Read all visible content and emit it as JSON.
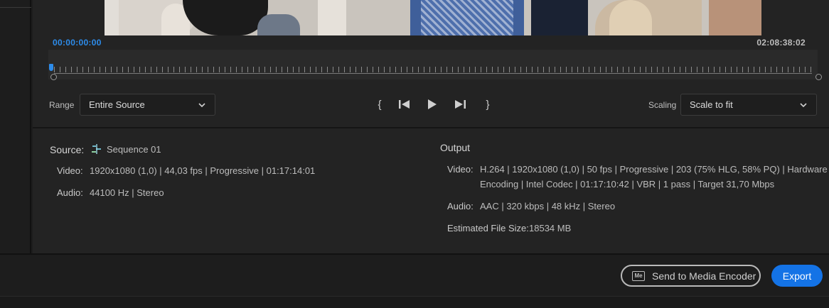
{
  "preview": {
    "timecode_start": "00:00:00:00",
    "timecode_end": "02:08:38:02"
  },
  "range": {
    "label": "Range",
    "value": "Entire Source"
  },
  "scaling": {
    "label": "Scaling",
    "value": "Scale to fit"
  },
  "transport": {
    "mark_in": "{",
    "mark_out": "}"
  },
  "source": {
    "heading": "Source:",
    "sequence_name": "Sequence 01",
    "video_label": "Video:",
    "video_value": "1920x1080 (1,0) | 44,03 fps | Progressive | 01:17:14:01",
    "audio_label": "Audio:",
    "audio_value": "44100 Hz | Stereo"
  },
  "output": {
    "heading": "Output",
    "video_label": "Video:",
    "video_line1": "H.264 | 1920x1080 (1,0) | 50 fps | Progressive | 203 (75% HLG, 58% PQ) | Hardware",
    "video_line2": "Encoding | Intel Codec | 01:17:10:42 | VBR | 1 pass | Target 31,70 Mbps",
    "audio_label": "Audio:",
    "audio_value": "AAC | 320 kbps | 48 kHz | Stereo",
    "filesize_label": "Estimated File Size:",
    "filesize_value": "18534 MB"
  },
  "footer": {
    "send_label": "Send to Media Encoder",
    "me_badge": "Me",
    "export_label": "Export"
  },
  "colors": {
    "accent": "#1473e6",
    "timecode": "#2d8ceb",
    "background": "#232323"
  }
}
